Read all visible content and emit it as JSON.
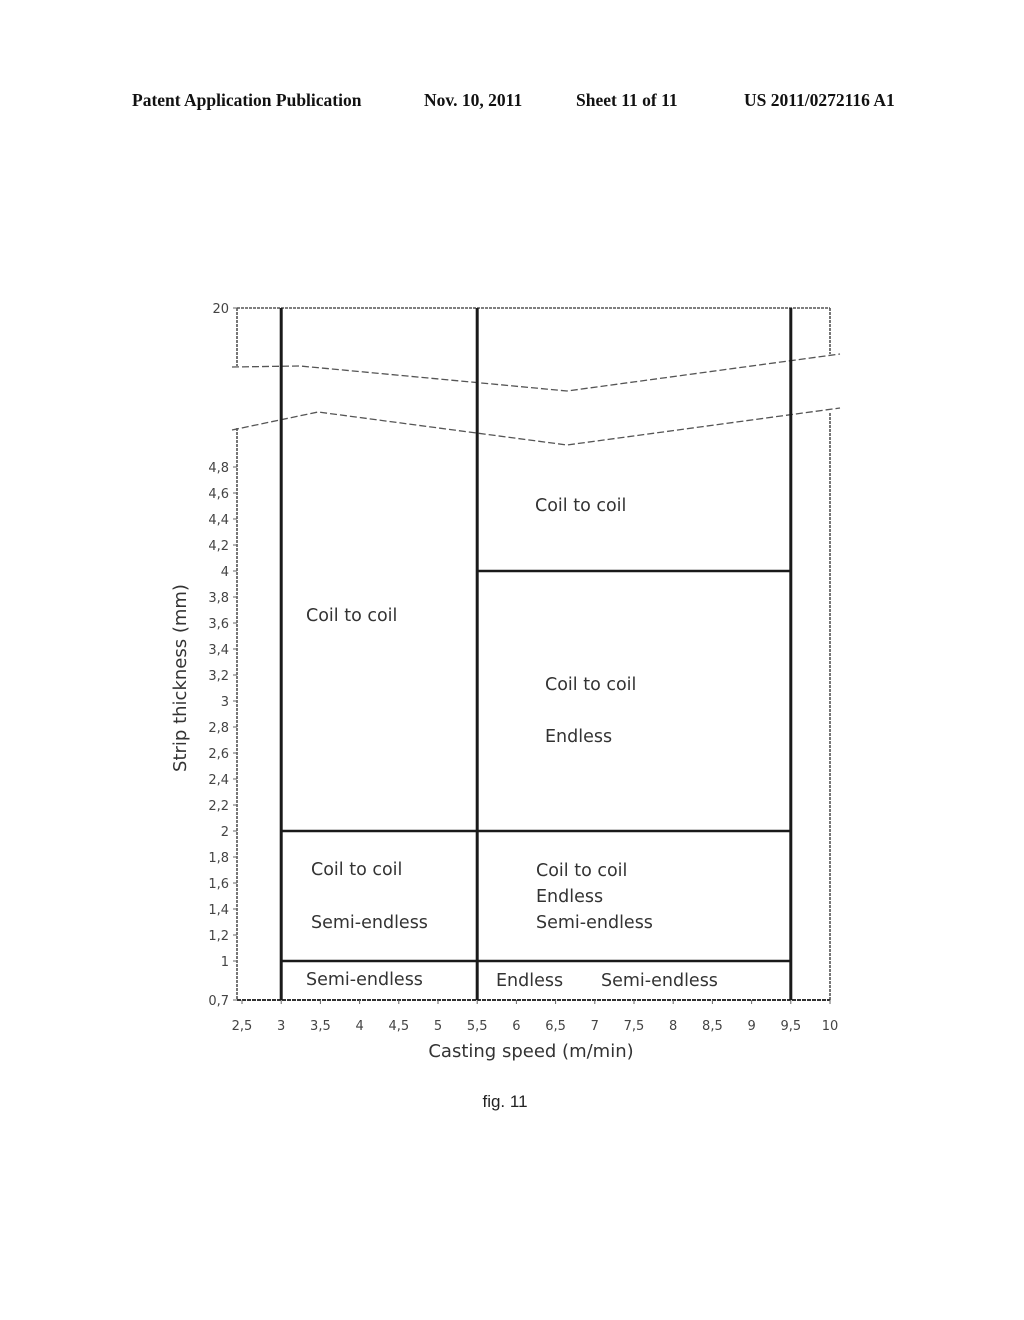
{
  "header": {
    "publication": "Patent Application Publication",
    "date": "Nov. 10, 2011",
    "sheet": "Sheet 11 of 11",
    "number": "US 2011/0272116 A1"
  },
  "caption": "fig. 11",
  "chart_data": {
    "type": "region-map",
    "title": "",
    "xlabel": "Casting speed (m/min)",
    "ylabel": "Strip thickness (mm)",
    "xlim": [
      2.5,
      10
    ],
    "ylim": [
      0.7,
      20
    ],
    "y_axis_break": [
      4.8,
      20
    ],
    "grid": false,
    "x_ticks": [
      "2,5",
      "3",
      "3,5",
      "4",
      "4,5",
      "5",
      "5,5",
      "6",
      "6,5",
      "7",
      "7,5",
      "8",
      "8,5",
      "9",
      "9,5",
      "10"
    ],
    "x_tick_values": [
      2.5,
      3,
      3.5,
      4,
      4.5,
      5,
      5.5,
      6,
      6.5,
      7,
      7.5,
      8,
      8.5,
      9,
      9.5,
      10
    ],
    "y_ticks": [
      "0,7",
      "1",
      "1,2",
      "1,4",
      "1,6",
      "1,8",
      "2",
      "2,2",
      "2,4",
      "2,6",
      "2,8",
      "3",
      "3,2",
      "3,4",
      "3,6",
      "3,8",
      "4",
      "4,2",
      "4,4",
      "4,6",
      "4,8",
      "20"
    ],
    "y_tick_values": [
      0.7,
      1,
      1.2,
      1.4,
      1.6,
      1.8,
      2,
      2.2,
      2.4,
      2.6,
      2.8,
      3,
      3.2,
      3.4,
      3.6,
      3.8,
      4,
      4.2,
      4.4,
      4.6,
      4.8,
      20
    ],
    "vertical_boundaries": [
      3,
      5.5,
      9.5
    ],
    "regions": [
      {
        "x": [
          3,
          5.5
        ],
        "y": [
          2,
          20
        ],
        "labels": [
          "Coil to coil"
        ]
      },
      {
        "x": [
          3,
          5.5
        ],
        "y": [
          1,
          2
        ],
        "labels": [
          "Coil to coil",
          "Semi-endless"
        ]
      },
      {
        "x": [
          3,
          5.5
        ],
        "y": [
          0.7,
          1
        ],
        "labels": [
          "Semi-endless"
        ]
      },
      {
        "x": [
          5.5,
          9.5
        ],
        "y": [
          4,
          20
        ],
        "labels": [
          "Coil to coil"
        ]
      },
      {
        "x": [
          5.5,
          9.5
        ],
        "y": [
          2,
          4
        ],
        "labels": [
          "Coil to coil",
          "Endless"
        ]
      },
      {
        "x": [
          5.5,
          9.5
        ],
        "y": [
          1,
          2
        ],
        "labels": [
          "Coil to coil",
          "Endless",
          "Semi-endless"
        ]
      },
      {
        "x": [
          5.5,
          9.5
        ],
        "y": [
          0.7,
          1
        ],
        "labels": [
          "Endless",
          "Semi-endless"
        ]
      }
    ]
  }
}
